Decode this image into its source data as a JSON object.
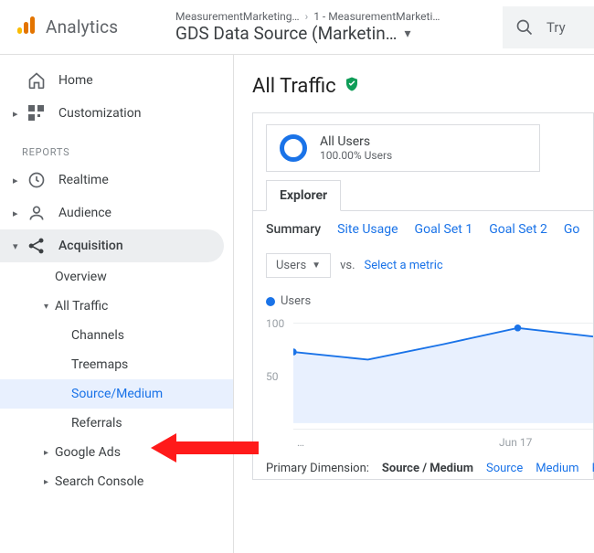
{
  "header": {
    "product": "Analytics",
    "crumb1": "MeasurementMarketing…",
    "crumb2": "1 - MeasurementMarketi…",
    "title": "GDS Data Source (Marketin…",
    "search_placeholder": "Try"
  },
  "sidebar": {
    "home": "Home",
    "customization": "Customization",
    "reports_label": "REPORTS",
    "realtime": "Realtime",
    "audience": "Audience",
    "acquisition": "Acquisition",
    "acq": {
      "overview": "Overview",
      "all_traffic": "All Traffic",
      "channels": "Channels",
      "treemaps": "Treemaps",
      "source_medium": "Source/Medium",
      "referrals": "Referrals",
      "google_ads": "Google Ads",
      "search_console": "Search Console"
    }
  },
  "page": {
    "title": "All Traffic",
    "segment_title": "All Users",
    "segment_sub": "100.00% Users",
    "tab": "Explorer",
    "subtabs": {
      "summary": "Summary",
      "site": "Site Usage",
      "g1": "Goal Set 1",
      "g2": "Goal Set 2",
      "g3": "Go"
    },
    "metric_name": "Users",
    "vs": "vs.",
    "select_metric": "Select a metric",
    "legend": "Users",
    "y100": "100",
    "y50": "50",
    "x_ellipsis": "…",
    "x_jun17": "Jun 17",
    "pdim_label": "Primary Dimension:",
    "pdim_active": "Source / Medium",
    "pdim_source": "Source",
    "pdim_medium": "Medium",
    "pdim_keyword": "Ke"
  },
  "chart_data": {
    "type": "line",
    "series": [
      {
        "name": "Users",
        "values": [
          70,
          62,
          78,
          94,
          86
        ]
      }
    ],
    "ylim": [
      0,
      110
    ],
    "ylabel": "Users",
    "xticks": [
      "…",
      "Jun 17"
    ]
  }
}
